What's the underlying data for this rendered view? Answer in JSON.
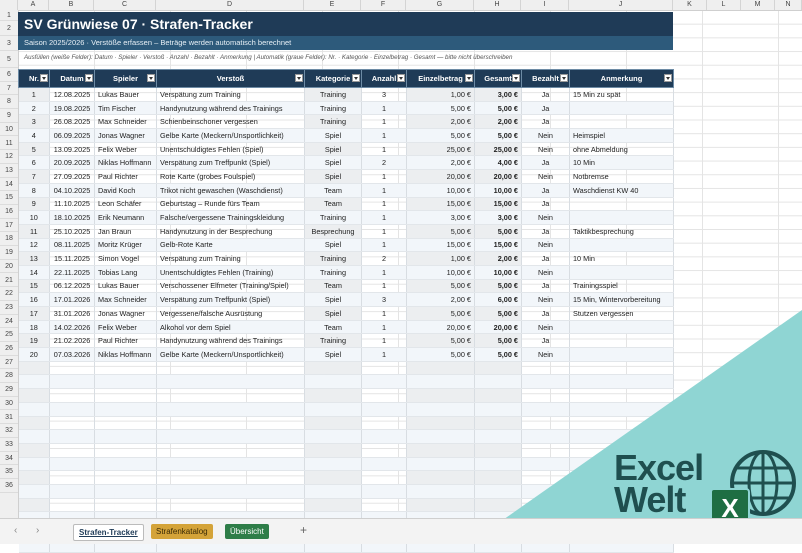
{
  "columns": [
    "A",
    "B",
    "C",
    "D",
    "E",
    "F",
    "G",
    "H",
    "I",
    "J",
    "K",
    "L",
    "M",
    "N"
  ],
  "rows": [
    "1",
    "2",
    "3",
    "5",
    "6",
    "7",
    "8",
    "9",
    "10",
    "11",
    "12",
    "13",
    "14",
    "15",
    "16",
    "17",
    "18",
    "19",
    "20",
    "21",
    "22",
    "23",
    "24",
    "25",
    "26",
    "27",
    "28",
    "29",
    "30",
    "31",
    "32",
    "33",
    "34",
    "35",
    "36"
  ],
  "title": "SV Grünwiese 07  ·  Strafen-Tracker",
  "subtitle": "Saison 2025/2026  ·  Verstöße erfassen – Beträge werden automatisch berechnet",
  "instructions": "Ausfüllen (weiße Felder): Datum · Spieler · Verstoß · Anzahl · Bezahlt · Anmerkung    |    Automatik (graue Felder): Nr. · Kategorie · Einzelbetrag · Gesamt  —  bitte nicht überschreiben",
  "headers": [
    "Nr.",
    "Datum",
    "Spieler",
    "Verstoß",
    "Kategorie",
    "Anzahl",
    "Einzelbetrag",
    "Gesamt",
    "Bezahlt",
    "Anmerkung"
  ],
  "entries": [
    [
      "1",
      "12.08.2025",
      "Lukas Bauer",
      "Verspätung zum Training",
      "Training",
      "3",
      "1,00 €",
      "3,00 €",
      "Ja",
      "15 Min zu spät"
    ],
    [
      "2",
      "19.08.2025",
      "Tim Fischer",
      "Handynutzung während des Trainings",
      "Training",
      "1",
      "5,00 €",
      "5,00 €",
      "Ja",
      ""
    ],
    [
      "3",
      "26.08.2025",
      "Max Schneider",
      "Schienbeinschoner vergessen",
      "Training",
      "1",
      "2,00 €",
      "2,00 €",
      "Ja",
      ""
    ],
    [
      "4",
      "06.09.2025",
      "Jonas Wagner",
      "Gelbe Karte (Meckern/Unsportlichkeit)",
      "Spiel",
      "1",
      "5,00 €",
      "5,00 €",
      "Nein",
      "Heimspiel"
    ],
    [
      "5",
      "13.09.2025",
      "Felix Weber",
      "Unentschuldigtes Fehlen (Spiel)",
      "Spiel",
      "1",
      "25,00 €",
      "25,00 €",
      "Nein",
      "ohne Abmeldung"
    ],
    [
      "6",
      "20.09.2025",
      "Niklas Hoffmann",
      "Verspätung zum Treffpunkt (Spiel)",
      "Spiel",
      "2",
      "2,00 €",
      "4,00 €",
      "Ja",
      "10 Min"
    ],
    [
      "7",
      "27.09.2025",
      "Paul Richter",
      "Rote Karte (grobes Foulspiel)",
      "Spiel",
      "1",
      "20,00 €",
      "20,00 €",
      "Nein",
      "Notbremse"
    ],
    [
      "8",
      "04.10.2025",
      "David Koch",
      "Trikot nicht gewaschen (Waschdienst)",
      "Team",
      "1",
      "10,00 €",
      "10,00 €",
      "Ja",
      "Waschdienst KW 40"
    ],
    [
      "9",
      "11.10.2025",
      "Leon Schäfer",
      "Geburtstag – Runde fürs Team",
      "Team",
      "1",
      "15,00 €",
      "15,00 €",
      "Ja",
      ""
    ],
    [
      "10",
      "18.10.2025",
      "Erik Neumann",
      "Falsche/vergessene Trainingskleidung",
      "Training",
      "1",
      "3,00 €",
      "3,00 €",
      "Nein",
      ""
    ],
    [
      "11",
      "25.10.2025",
      "Jan Braun",
      "Handynutzung in der Besprechung",
      "Besprechung",
      "1",
      "5,00 €",
      "5,00 €",
      "Ja",
      "Taktikbesprechung"
    ],
    [
      "12",
      "08.11.2025",
      "Moritz Krüger",
      "Gelb-Rote Karte",
      "Spiel",
      "1",
      "15,00 €",
      "15,00 €",
      "Nein",
      ""
    ],
    [
      "13",
      "15.11.2025",
      "Simon Vogel",
      "Verspätung zum Training",
      "Training",
      "2",
      "1,00 €",
      "2,00 €",
      "Ja",
      "10 Min"
    ],
    [
      "14",
      "22.11.2025",
      "Tobias Lang",
      "Unentschuldigtes Fehlen (Training)",
      "Training",
      "1",
      "10,00 €",
      "10,00 €",
      "Nein",
      ""
    ],
    [
      "15",
      "06.12.2025",
      "Lukas Bauer",
      "Verschossener Elfmeter (Training/Spiel)",
      "Team",
      "1",
      "5,00 €",
      "5,00 €",
      "Ja",
      "Trainingsspiel"
    ],
    [
      "16",
      "17.01.2026",
      "Max Schneider",
      "Verspätung zum Treffpunkt (Spiel)",
      "Spiel",
      "3",
      "2,00 €",
      "6,00 €",
      "Nein",
      "15 Min, Wintervorbereitung"
    ],
    [
      "17",
      "31.01.2026",
      "Jonas Wagner",
      "Vergessene/falsche Ausrüstung",
      "Spiel",
      "1",
      "5,00 €",
      "5,00 €",
      "Ja",
      "Stutzen vergessen"
    ],
    [
      "18",
      "14.02.2026",
      "Felix Weber",
      "Alkohol vor dem Spiel",
      "Team",
      "1",
      "20,00 €",
      "20,00 €",
      "Nein",
      ""
    ],
    [
      "19",
      "21.02.2026",
      "Paul Richter",
      "Handynutzung während des Trainings",
      "Training",
      "1",
      "5,00 €",
      "5,00 €",
      "Ja",
      ""
    ],
    [
      "20",
      "07.03.2026",
      "Niklas Hoffmann",
      "Gelbe Karte (Meckern/Unsportlichkeit)",
      "Spiel",
      "1",
      "5,00 €",
      "5,00 €",
      "Nein",
      ""
    ]
  ],
  "tabs": {
    "t1": "Strafen-Tracker",
    "t2": "Strafenkatalog",
    "t3": "Übersicht",
    "add": "+"
  },
  "logo": {
    "line1": "Excel",
    "line2": "Welt",
    "badge": "X"
  }
}
